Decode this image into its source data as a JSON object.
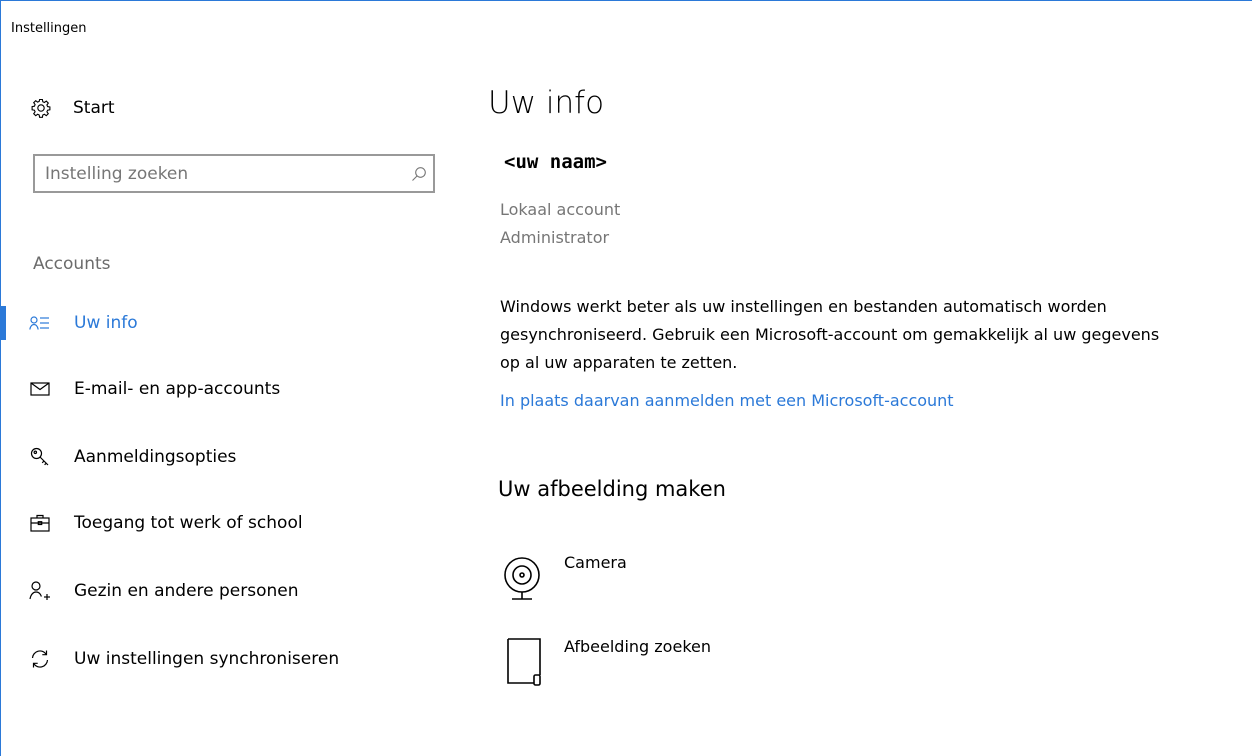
{
  "window": {
    "title": "Instellingen"
  },
  "sidebar": {
    "start_label": "Start",
    "search": {
      "placeholder": "Instelling zoeken",
      "value": ""
    },
    "group_label": "Accounts",
    "items": [
      {
        "label": "Uw info",
        "icon": "user-info-icon",
        "active": true
      },
      {
        "label": "E-mail- en app-accounts",
        "icon": "mail-icon",
        "active": false
      },
      {
        "label": "Aanmeldingsopties",
        "icon": "key-icon",
        "active": false
      },
      {
        "label": "Toegang tot werk of school",
        "icon": "briefcase-icon",
        "active": false
      },
      {
        "label": "Gezin en andere personen",
        "icon": "add-person-icon",
        "active": false
      },
      {
        "label": "Uw instellingen synchroniseren",
        "icon": "sync-icon",
        "active": false
      }
    ]
  },
  "main": {
    "title": "Uw info",
    "user_name": "<uw naam>",
    "account_type": "Lokaal account",
    "account_role": "Administrator",
    "description": "Windows werkt beter als uw instellingen en bestanden automatisch worden gesynchroniseerd. Gebruik een Microsoft-account om gemakkelijk al uw gegevens op al uw apparaten te zetten.",
    "signin_link": "In plaats daarvan aanmelden met een Microsoft-account",
    "picture_section": {
      "title": "Uw afbeelding maken",
      "options": [
        {
          "label": "Camera",
          "icon": "camera-icon"
        },
        {
          "label": "Afbeelding zoeken",
          "icon": "browse-file-icon"
        }
      ]
    }
  },
  "colors": {
    "accent": "#2b79d8",
    "secondary_text": "#767676",
    "search_border": "#999999"
  }
}
